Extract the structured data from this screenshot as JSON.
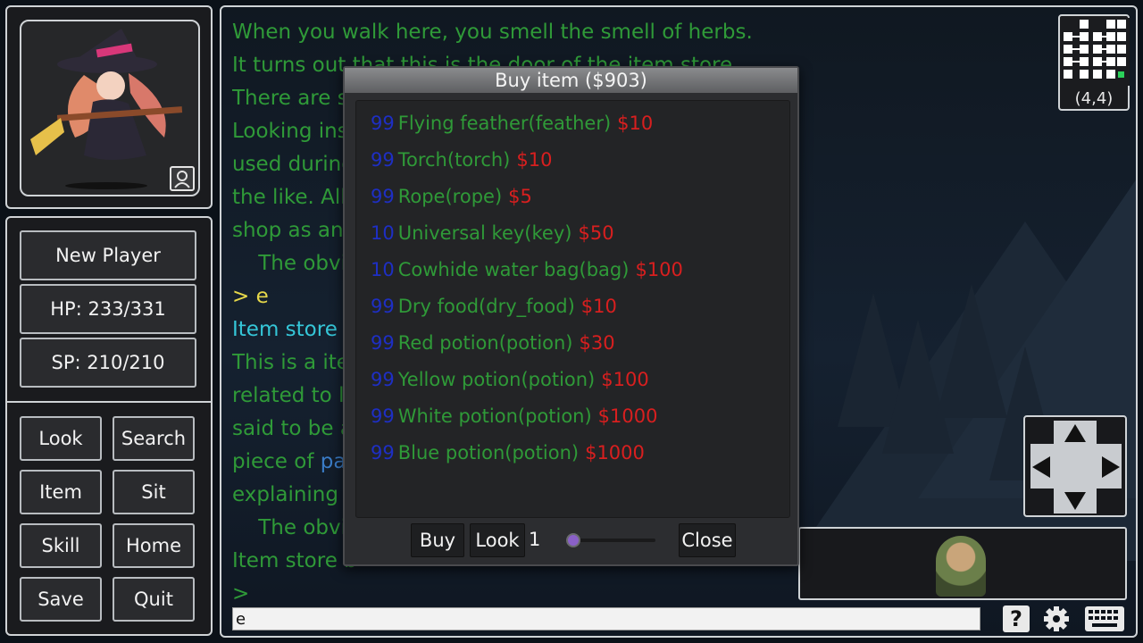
{
  "player": {
    "name": "New Player",
    "hp": "HP: 233/331",
    "sp": "SP: 210/210"
  },
  "commands": [
    "Look",
    "Search",
    "Item",
    "Sit",
    "Skill",
    "Home",
    "Save",
    "Quit"
  ],
  "story": {
    "l1": "When you walk here, you smell the smell of herbs.",
    "l2": "It turns out that this is the door of the item store.",
    "l3": "There are so",
    "l4": "Looking ins",
    "l5": "used during",
    "l6": "the like. All",
    "l7": "shop as an",
    "l8": "    The obvi",
    "prompt1": "> e",
    "l9": "Item store -",
    "l10": "This is a ite",
    "l11": "related to li",
    "l12": "said to be a",
    "l13a": "piece of ",
    "l13b": "pap",
    "l14": "explaining",
    "l15": "    The obvi",
    "l16": "Item store b",
    "prompt2": ">"
  },
  "input": {
    "value": "e"
  },
  "minimap": {
    "coords": "(4,4)"
  },
  "modal": {
    "title": "Buy item ($903)",
    "items": [
      {
        "qty": "99",
        "name": "Flying feather(feather)",
        "price": "$10"
      },
      {
        "qty": "99",
        "name": "Torch(torch)",
        "price": "$10"
      },
      {
        "qty": "99",
        "name": "Rope(rope)",
        "price": "$5"
      },
      {
        "qty": "10",
        "name": "Universal key(key)",
        "price": "$50"
      },
      {
        "qty": "10",
        "name": "Cowhide water bag(bag)",
        "price": "$100"
      },
      {
        "qty": "99",
        "name": "Dry food(dry_food)",
        "price": "$10"
      },
      {
        "qty": "99",
        "name": "Red potion(potion)",
        "price": "$30"
      },
      {
        "qty": "99",
        "name": "Yellow potion(potion)",
        "price": "$100"
      },
      {
        "qty": "99",
        "name": "White potion(potion)",
        "price": "$1000"
      },
      {
        "qty": "99",
        "name": "Blue potion(potion)",
        "price": "$1000"
      }
    ],
    "buy_label": "Buy",
    "look_label": "Look",
    "quantity": "1",
    "close_label": "Close"
  },
  "tools": {
    "help": "?"
  },
  "colors": {
    "qty": "#1e2fc4",
    "item_name": "#2f9a38",
    "price": "#d81f1f",
    "story_text": "#2f9a38"
  }
}
